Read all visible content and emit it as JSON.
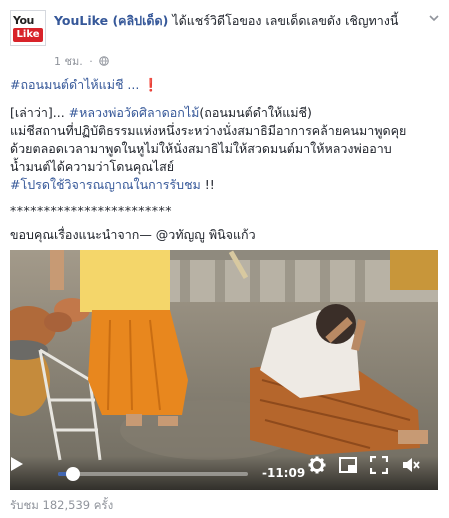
{
  "header": {
    "avatar_top": "You",
    "avatar_bottom": "Like",
    "page_name": "YouLike (คลิปเด็ด)",
    "action_text": "ได้แชร์วิดีโอของ เลขเด็ดเลขดัง เชิญทางนี้",
    "time": "1 ชม.",
    "privacy_icon": "globe-icon",
    "options_icon": "chevron-down-icon"
  },
  "post": {
    "headline_tag": "#ถอนมนต์ดำไห้แม่ชี ...",
    "headline_mark": "❗",
    "line1_prefix": "[เล่าว่า]...",
    "line1_tag": "#หลวงพ่อวัดศิลาดอกไม้",
    "line1_suffix": "(ถอนมนต์ดำให้แม่ชี)",
    "line2": "แม่ชีสถานที่ปฏิบัติธรรมแห่งหนึ่งระหว่างนั่งสมาธิมีอาการคล้ายคนมาพูดคุย",
    "line3": "ด้วยตลอดเวลามาพูดในหูไม่ให้นั่งสมาธิไม่ให้สวดมนต์มาให้หลวงพ่ออาบ",
    "line4": "น้ำมนต์ได้ความว่าโดนคุณไสย์",
    "line5_tag": "#โปรดใช้วิจารณญาณในการรับชม",
    "line5_suffix": "!!",
    "stars": "************************",
    "thanks": "ขอบคุณเรื่องแนะนำจาก— @วทัญญู พินิจแก้ว"
  },
  "video": {
    "time_remaining": "-11:09",
    "progress_fraction": 0.08,
    "colors": {
      "robe": "#e8871e",
      "sarong": "#b5662c",
      "accent": "#4267b2"
    }
  },
  "footer": {
    "views": "รับชม 182,539 ครั้ง"
  }
}
